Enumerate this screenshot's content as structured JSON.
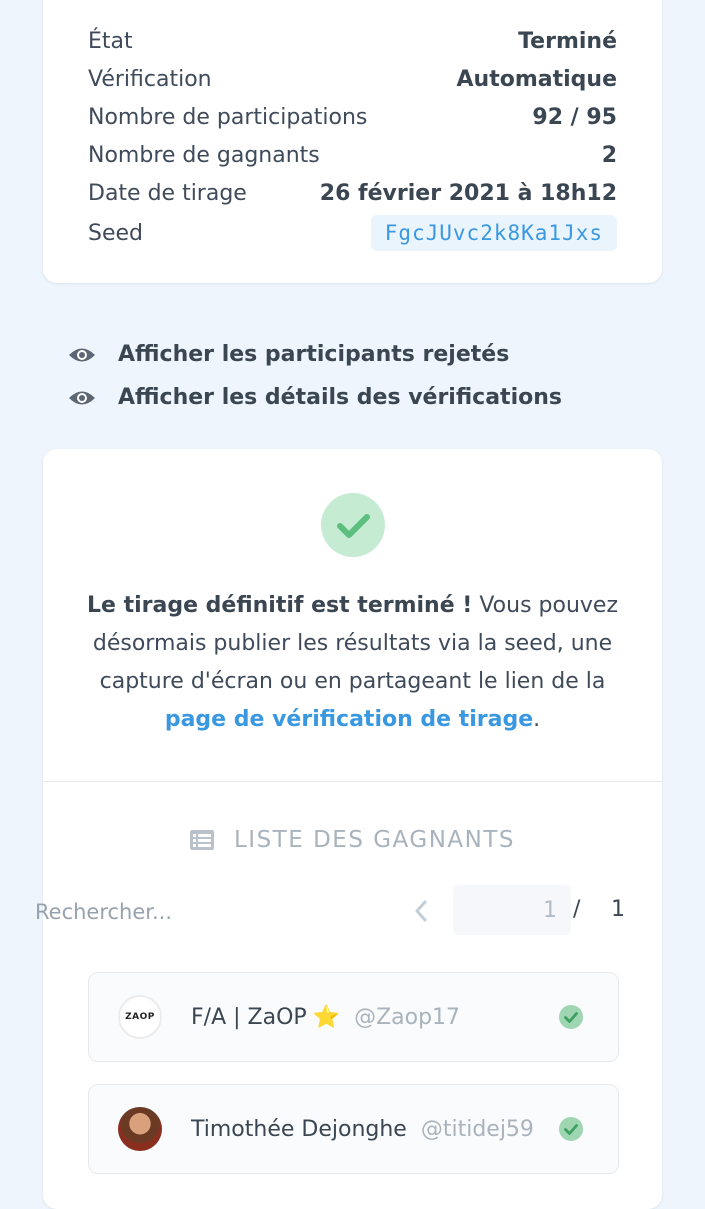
{
  "info": {
    "rows": [
      {
        "label": "État",
        "value": "Terminé"
      },
      {
        "label": "Vérification",
        "value": "Automatique"
      },
      {
        "label": "Nombre de participations",
        "value": "92 / 95"
      },
      {
        "label": "Nombre de gagnants",
        "value": "2"
      },
      {
        "label": "Date de tirage",
        "value": "26 février 2021 à 18h12"
      },
      {
        "label": "Seed",
        "value": "FgcJUvc2k8Ka1Jxs"
      }
    ]
  },
  "toggles": {
    "rejected": "Afficher les participants rejetés",
    "verifications": "Afficher les détails des vérifications"
  },
  "result": {
    "bold": "Le tirage définitif est terminé !",
    "text": " Vous pouvez désormais publier les résultats via la seed, une capture d'écran ou en partageant le lien de la ",
    "link": "page de vérification de tirage",
    "end": "."
  },
  "winners_list": {
    "title": "LISTE DES GAGNANTS",
    "search_placeholder": "Rechercher...",
    "page_current": "1",
    "page_sep": "/",
    "page_total": "1",
    "winners": [
      {
        "name": "F/A | ZaOP",
        "badge": "⭐",
        "handle": "@Zaop17",
        "avatar_text": "ZAOP"
      },
      {
        "name": "Timothée Dejonghe",
        "badge": "",
        "handle": "@titidej59",
        "avatar_text": ""
      }
    ]
  },
  "colors": {
    "accent": "#3a98e0",
    "success": "#5cbf7e",
    "background": "#eef5fc"
  }
}
